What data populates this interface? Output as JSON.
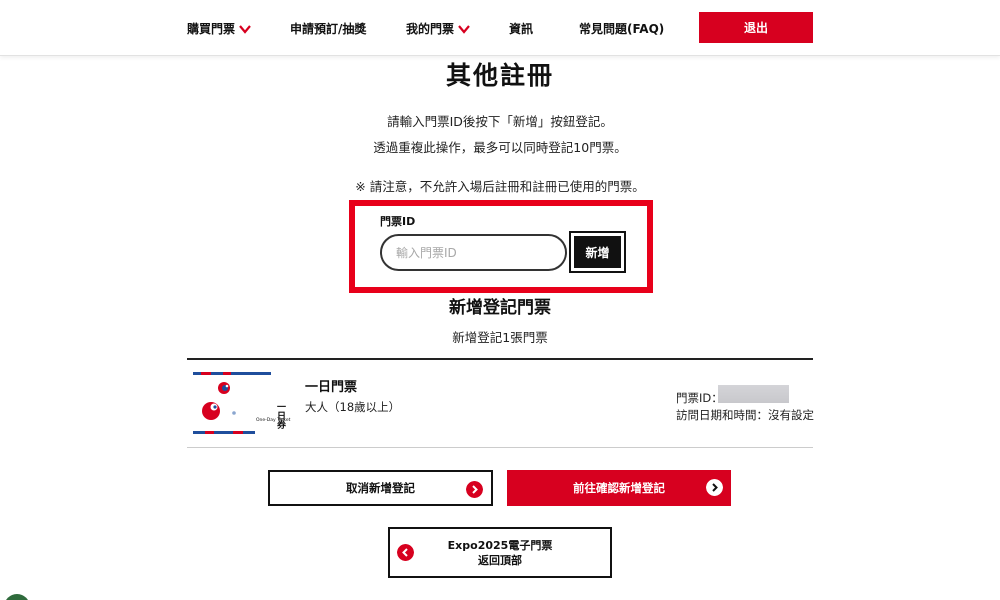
{
  "colors": {
    "accent": "#d7001f",
    "highlight_box": "#e8001a",
    "dark": "#111111"
  },
  "nav": {
    "items": [
      {
        "label": "購買門票",
        "has_dropdown": true
      },
      {
        "label": "申請預訂/抽獎",
        "has_dropdown": false
      },
      {
        "label": "我的門票",
        "has_dropdown": true
      },
      {
        "label": "資訊",
        "has_dropdown": false
      },
      {
        "label": "常見問題(FAQ)",
        "has_dropdown": false
      }
    ],
    "logout_label": "退出"
  },
  "page": {
    "title": "其他註冊",
    "instruction_1": "請輸入門票ID後按下「新增」按鈕登記。",
    "instruction_2": "透過重複此操作，最多可以同時登記10門票。",
    "notice": "※ 請注意，不允許入場后註冊和註冊已使用的門票。"
  },
  "form": {
    "label": "門票ID",
    "placeholder": "輸入門票ID",
    "value": "",
    "add_button": "新增"
  },
  "registered": {
    "title": "新增登記門票",
    "count_text": "新增登記1張門票",
    "tickets": [
      {
        "image_text_main": "一日券",
        "image_text_en": "One-Day Ticket",
        "name": "一日門票",
        "type": "大人（18歲以上）",
        "id_label": "門票ID：",
        "visit_label": "訪問日期和時間：沒有設定"
      }
    ]
  },
  "actions": {
    "cancel": "取消新增登記",
    "confirm": "前往確認新增登記",
    "back_line1": "Expo2025電子門票",
    "back_line2": "返回頂部"
  }
}
